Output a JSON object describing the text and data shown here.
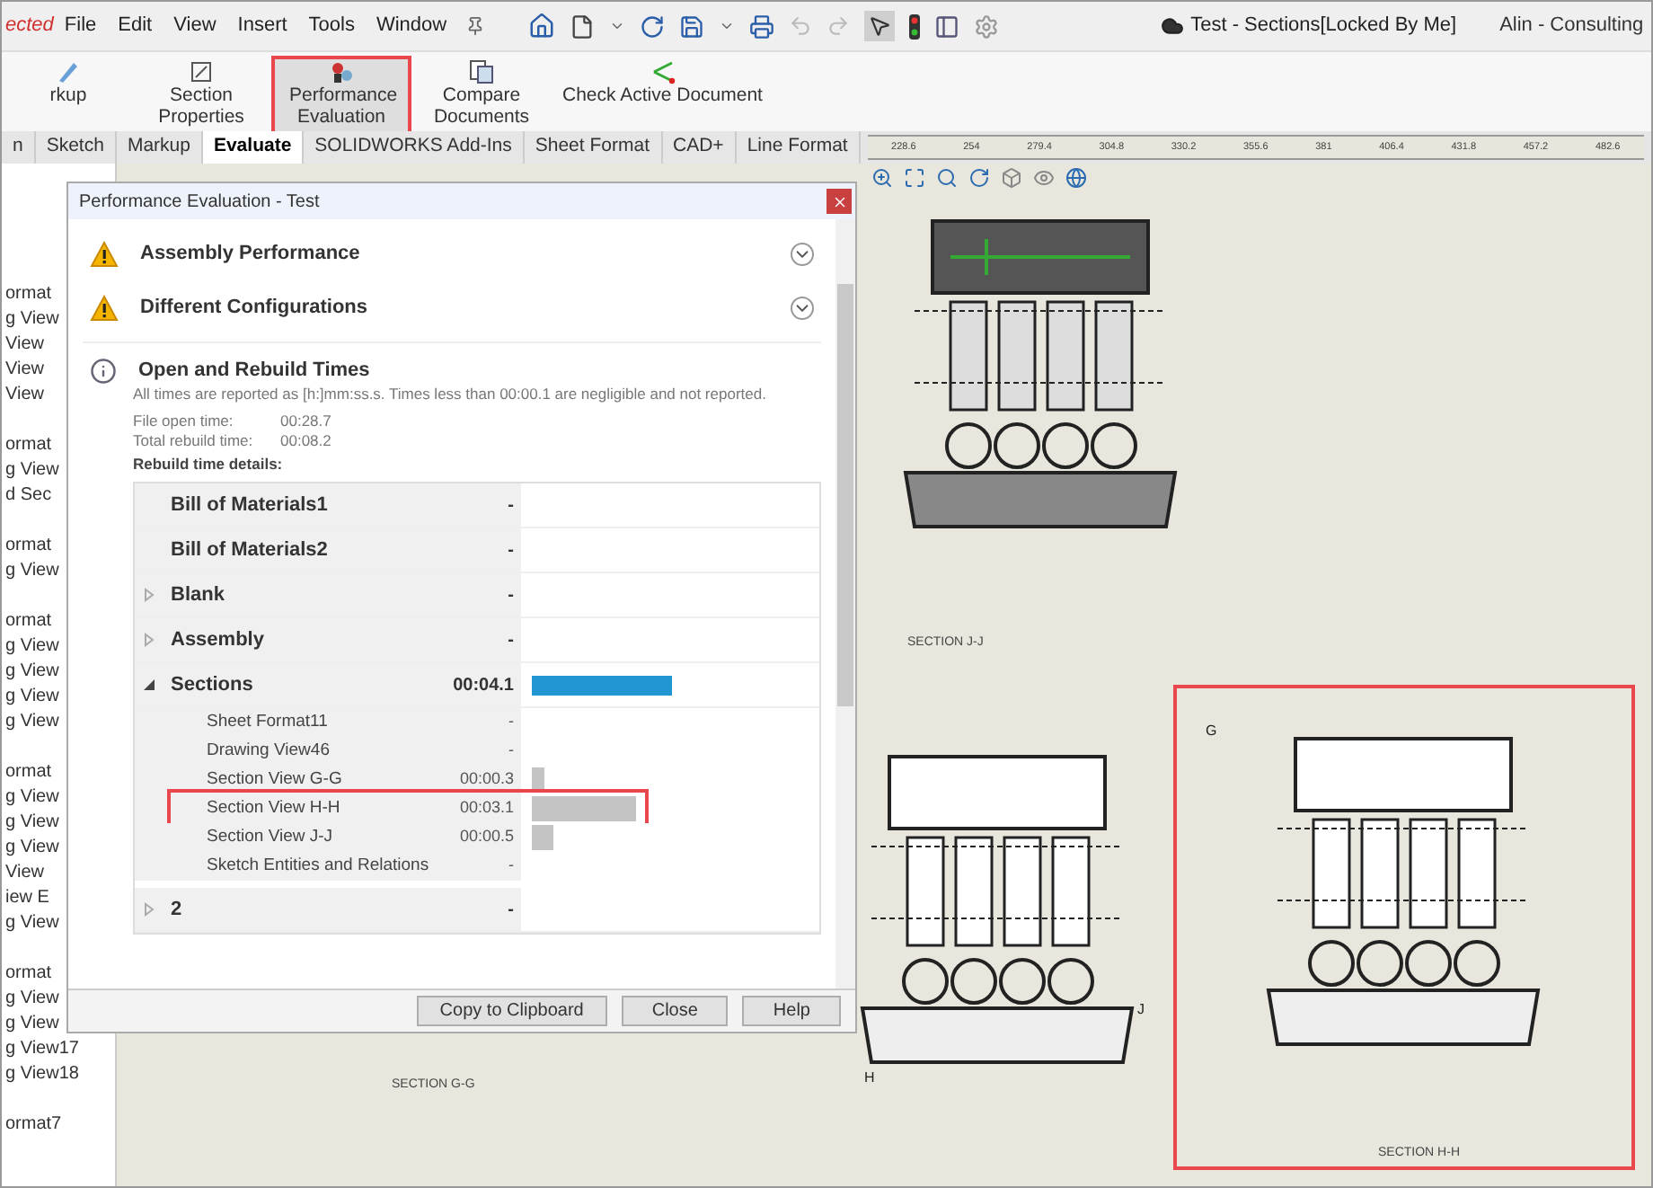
{
  "title_bar": {
    "app_status": "ected",
    "menu": [
      "File",
      "Edit",
      "View",
      "Insert",
      "Tools",
      "Window"
    ],
    "document_title": "Test - Sections[Locked By Me]",
    "account": "Alin - Consulting"
  },
  "ribbon": {
    "buttons": [
      {
        "label": "rkup",
        "highlighted": false
      },
      {
        "label": "Section Properties",
        "highlighted": false
      },
      {
        "label": "Performance Evaluation",
        "highlighted": true
      },
      {
        "label": "Compare Documents",
        "highlighted": false
      },
      {
        "label": "Check Active Document",
        "highlighted": false
      }
    ]
  },
  "tabs": [
    {
      "label": "n",
      "selected": false
    },
    {
      "label": "Sketch",
      "selected": false
    },
    {
      "label": "Markup",
      "selected": false
    },
    {
      "label": "Evaluate",
      "selected": true
    },
    {
      "label": "SOLIDWORKS Add-Ins",
      "selected": false
    },
    {
      "label": "Sheet Format",
      "selected": false
    },
    {
      "label": "CAD+",
      "selected": false
    },
    {
      "label": "Line Format",
      "selected": false
    }
  ],
  "ruler": {
    "ticks": [
      "228.6",
      "254",
      "279.4",
      "304.8",
      "330.2",
      "355.6",
      "381",
      "406.4",
      "431.8",
      "457.2",
      "482.6"
    ]
  },
  "feature_tree": {
    "groups": [
      [
        "ormat",
        "g View",
        "View",
        "View",
        "View"
      ],
      [
        "ormat",
        "g View",
        "d Sec"
      ],
      [
        "ormat",
        "g View"
      ],
      [
        "ormat",
        "g View",
        "g View",
        "g View",
        "g View"
      ],
      [
        "ormat",
        "g View",
        "g View",
        "g View",
        "View",
        "iew E",
        "g View"
      ],
      [
        "ormat",
        "g View",
        "g View",
        "g View17",
        "g View18"
      ],
      [
        "ormat7"
      ]
    ]
  },
  "dialog": {
    "title": "Performance Evaluation - Test",
    "warnings": [
      {
        "title": "Assembly Performance",
        "kind": "warning"
      },
      {
        "title": "Different Configurations",
        "kind": "warning"
      },
      {
        "title": "Open and Rebuild Times",
        "kind": "info"
      }
    ],
    "note": "All times are reported as [h:]mm:ss.s. Times less than 00:00.1 are negligible and not reported.",
    "times": [
      {
        "label": "File open time:",
        "value": "00:28.7"
      },
      {
        "label": "Total rebuild time:",
        "value": "00:08.2"
      }
    ],
    "details_label": "Rebuild time details:",
    "rows": [
      {
        "name": "Bill of Materials1",
        "time": "-"
      },
      {
        "name": "Bill of Materials2",
        "time": "-"
      },
      {
        "name": "Blank",
        "time": "-",
        "expanded": false
      },
      {
        "name": "Assembly",
        "time": "-",
        "expanded": false
      },
      {
        "name": "Sections",
        "time": "00:04.1",
        "expanded": true,
        "level": 0.47,
        "children": [
          {
            "name": "Sheet Format11",
            "time": "-",
            "highlighted": false
          },
          {
            "name": "Drawing View46",
            "time": "-",
            "highlighted": false
          },
          {
            "name": "Section View G-G",
            "time": "00:00.3",
            "level": 0.04,
            "highlighted": false
          },
          {
            "name": "Section View H-H",
            "time": "00:03.1",
            "level": 0.35,
            "highlighted": true
          },
          {
            "name": "Section View J-J",
            "time": "00:00.5",
            "level": 0.07,
            "highlighted": false
          },
          {
            "name": "Sketch Entities and Relations",
            "time": "-",
            "highlighted": false
          }
        ]
      },
      {
        "name": "2",
        "time": "-",
        "expanded": false
      }
    ],
    "buttons": [
      "Copy to Clipboard",
      "Close",
      "Help"
    ]
  },
  "sheet": {
    "views": [
      {
        "label": "SECTION J-J",
        "kind": "model",
        "highlighted": false
      },
      {
        "label": "SECTION G-G",
        "kind": "section",
        "highlighted": false
      },
      {
        "label": "SECTION H-H",
        "kind": "section",
        "highlighted": true
      }
    ],
    "cut_markers": [
      "G",
      "H",
      "J"
    ]
  }
}
